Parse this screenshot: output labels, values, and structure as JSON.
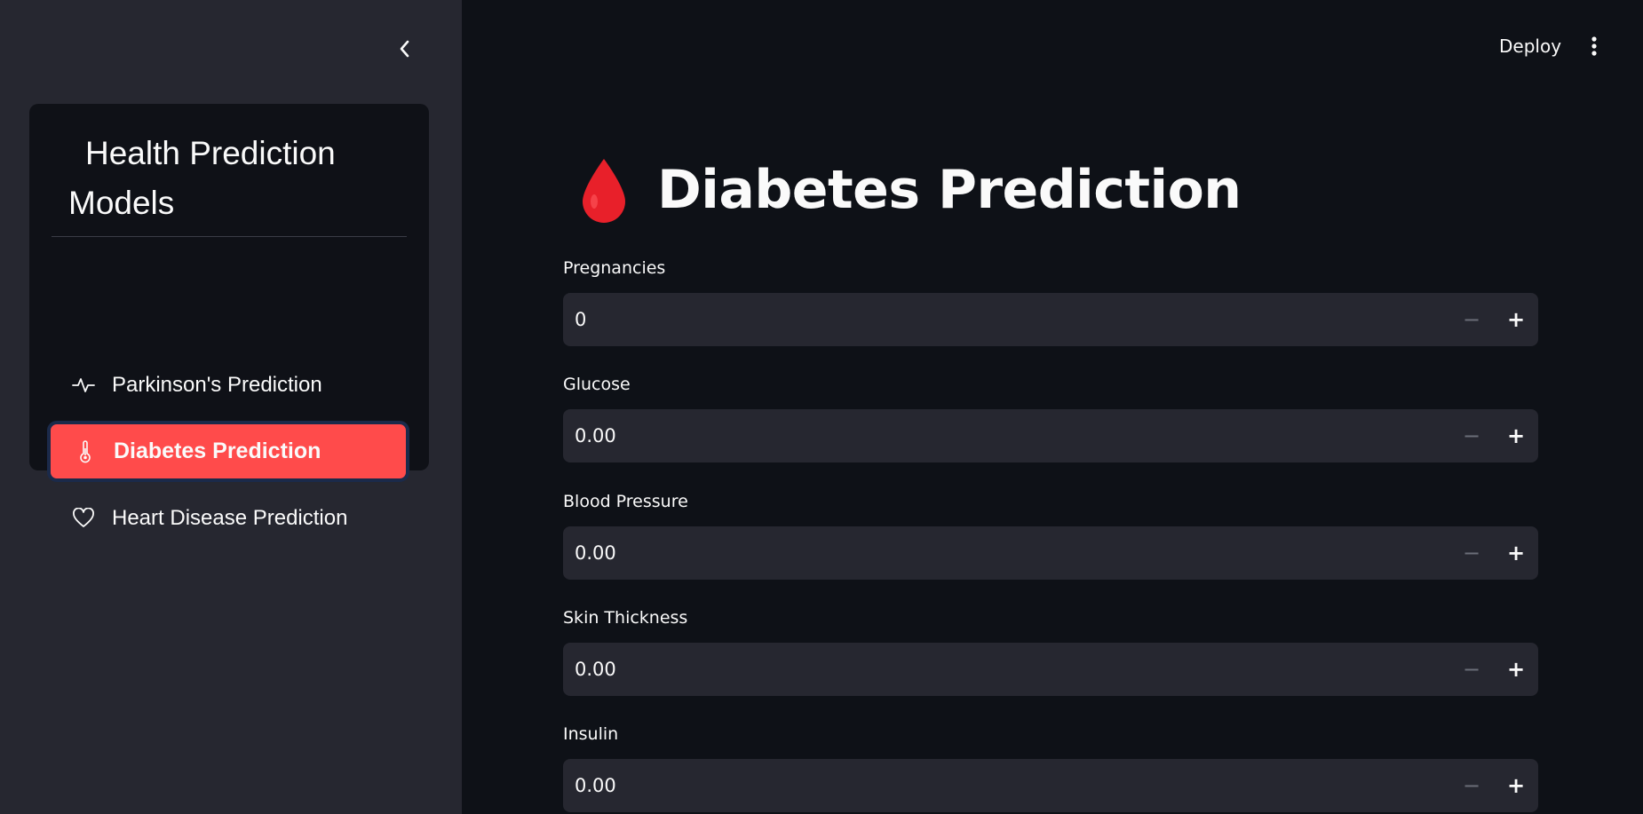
{
  "sidebar": {
    "menu_title": "Health Prediction Models",
    "items": [
      {
        "label": "Parkinson's Prediction",
        "icon": "activity-icon"
      },
      {
        "label": "Diabetes Prediction",
        "icon": "thermometer-icon",
        "active": true
      },
      {
        "label": "Heart Disease Prediction",
        "icon": "heart-icon"
      }
    ]
  },
  "header": {
    "deploy_label": "Deploy"
  },
  "main": {
    "title": "Diabetes Prediction",
    "title_icon": "blood-drop-icon",
    "fields": [
      {
        "label": "Pregnancies",
        "value": "0"
      },
      {
        "label": "Glucose",
        "value": "0.00"
      },
      {
        "label": "Blood Pressure",
        "value": "0.00"
      },
      {
        "label": "Skin Thickness",
        "value": "0.00"
      },
      {
        "label": "Insulin",
        "value": "0.00"
      }
    ],
    "stepper": {
      "minus": "−",
      "plus": "+"
    }
  },
  "colors": {
    "accent": "#ff4b4b",
    "sidebar_bg": "#262730",
    "main_bg": "#0e1117",
    "input_bg": "#262730"
  }
}
